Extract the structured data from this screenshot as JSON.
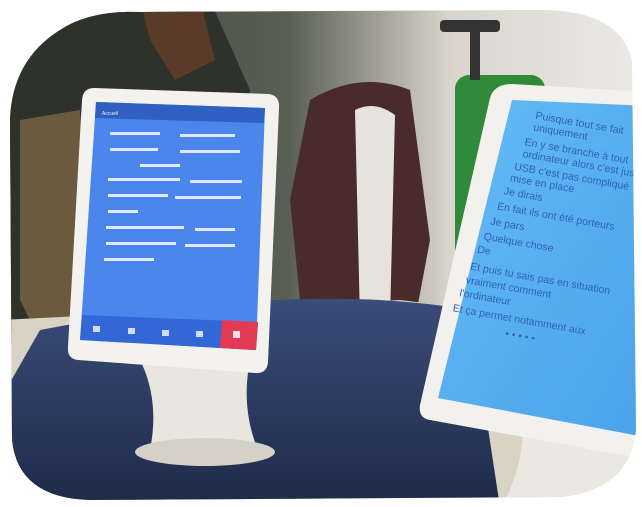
{
  "left_tablet": {
    "app_title": "Accueil",
    "nav_labels": [
      "",
      "",
      "",
      "",
      ""
    ]
  },
  "right_tablet": {
    "lines": [
      "Puisque tout se fait",
      "uniquement",
      "En y se branche à tout",
      "ordinateur alors c'est juste",
      "USB c'est pas compliqué",
      "mise en place",
      "Je dirais",
      "En fait ils ont été porteurs",
      "Je pars",
      "Quelque chose",
      "De",
      "Et puis tu sais pas en situation",
      "vraiment comment",
      "l'ordinateur",
      "Et ça permet notamment aux",
      "• • • • •"
    ]
  },
  "colors": {
    "wall": "#e9e6e1",
    "table_cloth": "#2e3f66",
    "tablet_screen_left": "#4a86ec",
    "tablet_screen_right": "#59b0f0",
    "accent_button": "#e23a52"
  }
}
